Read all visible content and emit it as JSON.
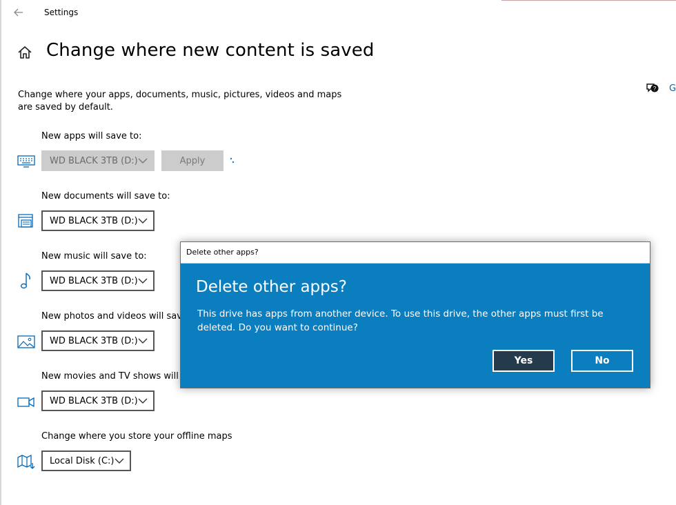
{
  "window": {
    "title": "Settings"
  },
  "page": {
    "title": "Change where new content is saved",
    "description": "Change where your apps, documents, music, pictures, videos and maps are saved by default."
  },
  "help": {
    "label": "G"
  },
  "sections": [
    {
      "label": "New apps will save to:",
      "value": "WD BLACK 3TB (D:)",
      "icon": "keyboard-icon"
    },
    {
      "label": "New documents will save to:",
      "value": "WD BLACK 3TB (D:)",
      "icon": "documents-icon"
    },
    {
      "label": "New music will save to:",
      "value": "WD BLACK 3TB (D:)",
      "icon": "music-note-icon"
    },
    {
      "label": "New photos and videos will save to:",
      "value": "WD BLACK 3TB (D:)",
      "icon": "photo-icon"
    },
    {
      "label": "New movies and TV shows will save to:",
      "value": "WD BLACK 3TB (D:)",
      "icon": "video-camera-icon"
    },
    {
      "label": "Change where you store your offline maps",
      "value": "Local Disk (C:)",
      "icon": "map-icon"
    }
  ],
  "apply_label": "Apply",
  "dialog": {
    "window_title": "Delete other apps?",
    "heading": "Delete other apps?",
    "message": "This drive has apps from another device. To use this drive, the other apps must first be deleted. Do you want to continue?",
    "yes_label": "Yes",
    "no_label": "No"
  },
  "colors": {
    "accent": "#0b7ec0",
    "dialog_yes_bg": "#253a4a",
    "link": "#0067b8"
  }
}
